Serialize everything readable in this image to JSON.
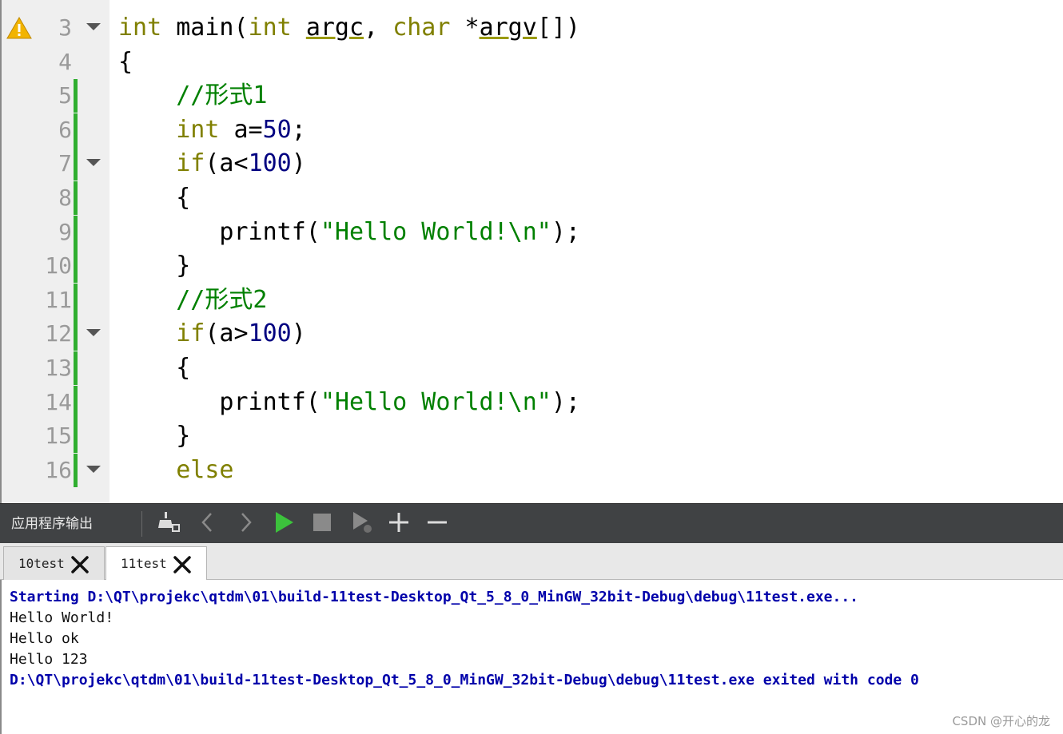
{
  "editor": {
    "lines": [
      {
        "num": "3",
        "warn": true,
        "fold": true,
        "changed": false,
        "tokens": [
          [
            "kw",
            "int"
          ],
          [
            "p",
            " main("
          ],
          [
            "kw",
            "int"
          ],
          [
            "p",
            " "
          ],
          [
            "und",
            "argc"
          ],
          [
            "p",
            ", "
          ],
          [
            "kw",
            "char"
          ],
          [
            "p",
            " *"
          ],
          [
            "und",
            "argv"
          ],
          [
            "p",
            "[])"
          ]
        ]
      },
      {
        "num": "4",
        "warn": false,
        "fold": false,
        "changed": false,
        "tokens": [
          [
            "p",
            "{"
          ]
        ]
      },
      {
        "num": "5",
        "warn": false,
        "fold": false,
        "changed": true,
        "tokens": [
          [
            "p",
            "    "
          ],
          [
            "cmt",
            "//形式1"
          ]
        ]
      },
      {
        "num": "6",
        "warn": false,
        "fold": false,
        "changed": true,
        "tokens": [
          [
            "p",
            "    "
          ],
          [
            "kw",
            "int"
          ],
          [
            "p",
            " a="
          ],
          [
            "num",
            "50"
          ],
          [
            "p",
            ";"
          ]
        ]
      },
      {
        "num": "7",
        "warn": false,
        "fold": true,
        "changed": true,
        "tokens": [
          [
            "p",
            "    "
          ],
          [
            "kw",
            "if"
          ],
          [
            "p",
            "(a<"
          ],
          [
            "num",
            "100"
          ],
          [
            "p",
            ")"
          ]
        ]
      },
      {
        "num": "8",
        "warn": false,
        "fold": false,
        "changed": true,
        "tokens": [
          [
            "p",
            "    {"
          ]
        ]
      },
      {
        "num": "9",
        "warn": false,
        "fold": false,
        "changed": true,
        "tokens": [
          [
            "p",
            "       printf("
          ],
          [
            "str",
            "\"Hello World!\\n\""
          ],
          [
            "p",
            ");"
          ]
        ]
      },
      {
        "num": "10",
        "warn": false,
        "fold": false,
        "changed": true,
        "tokens": [
          [
            "p",
            "    }"
          ]
        ]
      },
      {
        "num": "11",
        "warn": false,
        "fold": false,
        "changed": true,
        "tokens": [
          [
            "p",
            "    "
          ],
          [
            "cmt",
            "//形式2"
          ]
        ]
      },
      {
        "num": "12",
        "warn": false,
        "fold": true,
        "changed": true,
        "tokens": [
          [
            "p",
            "    "
          ],
          [
            "kw",
            "if"
          ],
          [
            "p",
            "(a>"
          ],
          [
            "num",
            "100"
          ],
          [
            "p",
            ")"
          ]
        ]
      },
      {
        "num": "13",
        "warn": false,
        "fold": false,
        "changed": true,
        "tokens": [
          [
            "p",
            "    {"
          ]
        ]
      },
      {
        "num": "14",
        "warn": false,
        "fold": false,
        "changed": true,
        "tokens": [
          [
            "p",
            "       printf("
          ],
          [
            "str",
            "\"Hello World!\\n\""
          ],
          [
            "p",
            ");"
          ]
        ]
      },
      {
        "num": "15",
        "warn": false,
        "fold": false,
        "changed": true,
        "tokens": [
          [
            "p",
            "    }"
          ]
        ]
      },
      {
        "num": "16",
        "warn": false,
        "fold": true,
        "changed": true,
        "tokens": [
          [
            "p",
            "    "
          ],
          [
            "kw",
            "else"
          ]
        ]
      }
    ]
  },
  "output_panel": {
    "title": "应用程序输出",
    "toolbar": [
      {
        "name": "clean-output-icon"
      },
      {
        "name": "previous-icon"
      },
      {
        "name": "next-icon"
      },
      {
        "name": "run-icon"
      },
      {
        "name": "stop-icon"
      },
      {
        "name": "attach-debugger-icon"
      },
      {
        "name": "zoom-in-icon"
      },
      {
        "name": "zoom-out-icon"
      }
    ],
    "tabs": [
      {
        "label": "10test",
        "active": false
      },
      {
        "label": "11test",
        "active": true
      }
    ],
    "console": [
      {
        "text": "Starting D:\\QT\\projekc\\qtdm\\01\\build-11test-Desktop_Qt_5_8_0_MinGW_32bit-Debug\\debug\\11test.exe...",
        "system": true
      },
      {
        "text": "Hello World!",
        "system": false
      },
      {
        "text": "Hello ok",
        "system": false
      },
      {
        "text": "Hello 123",
        "system": false
      },
      {
        "text": "D:\\QT\\projekc\\qtdm\\01\\build-11test-Desktop_Qt_5_8_0_MinGW_32bit-Debug\\debug\\11test.exe exited with code 0",
        "system": true
      }
    ]
  },
  "colors": {
    "keyword": "#808000",
    "number": "#000080",
    "string": "#008000",
    "system_output": "#0000aa"
  },
  "watermark": "CSDN @开心的龙"
}
